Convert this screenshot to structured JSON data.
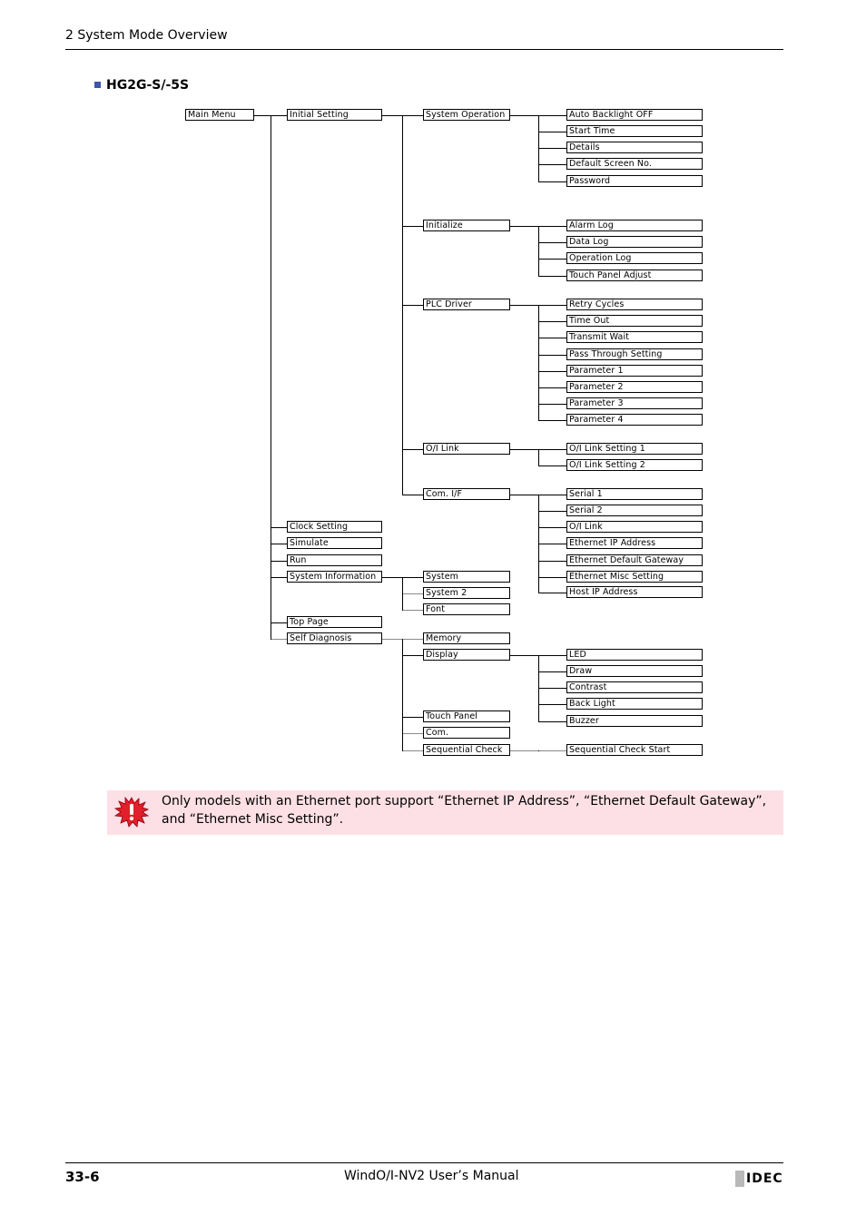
{
  "header": {
    "section": "2 System Mode Overview"
  },
  "section_title": "HG2G-S/-5S",
  "tree": {
    "label": "Main Menu",
    "children": [
      {
        "label": "Initial Setting",
        "children": [
          {
            "label": "System Operation",
            "children": [
              {
                "label": "Auto Backlight OFF"
              },
              {
                "label": "Start Time"
              },
              {
                "label": "Details"
              },
              {
                "label": "Default Screen No."
              },
              {
                "label": "Password"
              }
            ]
          },
          {
            "label": "Initialize",
            "children": [
              {
                "label": "Alarm Log"
              },
              {
                "label": "Data Log"
              },
              {
                "label": "Operation Log"
              },
              {
                "label": "Touch Panel Adjust"
              }
            ]
          },
          {
            "label": "PLC Driver",
            "children": [
              {
                "label": "Retry Cycles"
              },
              {
                "label": "Time Out"
              },
              {
                "label": "Transmit Wait"
              },
              {
                "label": "Pass Through Setting"
              },
              {
                "label": "Parameter 1"
              },
              {
                "label": "Parameter 2"
              },
              {
                "label": "Parameter 3"
              },
              {
                "label": "Parameter 4"
              }
            ]
          },
          {
            "label": "O/I Link",
            "children": [
              {
                "label": "O/I Link Setting 1"
              },
              {
                "label": "O/I Link Setting 2"
              }
            ]
          },
          {
            "label": "Com. I/F",
            "children": [
              {
                "label": "Serial 1"
              },
              {
                "label": "Serial 2"
              },
              {
                "label": "O/I Link"
              },
              {
                "label": "Ethernet IP Address"
              },
              {
                "label": "Ethernet Default Gateway"
              },
              {
                "label": "Ethernet Misc Setting"
              },
              {
                "label": "Host IP Address"
              }
            ]
          }
        ]
      },
      {
        "label": "Clock Setting"
      },
      {
        "label": "Simulate"
      },
      {
        "label": "Run"
      },
      {
        "label": "System Information",
        "children": [
          {
            "label": "System"
          },
          {
            "label": "System 2"
          },
          {
            "label": "Font"
          }
        ]
      },
      {
        "label": "Top Page"
      },
      {
        "label": "Self Diagnosis",
        "children": [
          {
            "label": "Memory"
          },
          {
            "label": "Display",
            "children": [
              {
                "label": "LED"
              },
              {
                "label": "Draw"
              },
              {
                "label": "Contrast"
              },
              {
                "label": "Back Light"
              },
              {
                "label": "Buzzer"
              }
            ]
          },
          {
            "label": "Touch Panel"
          },
          {
            "label": "Com."
          },
          {
            "label": "Sequential Check",
            "children": [
              {
                "label": "Sequential Check Start"
              }
            ]
          }
        ]
      }
    ]
  },
  "note": {
    "icon": "warning-burst-icon",
    "text": "Only models with an Ethernet port support “Ethernet IP Address”, “Ethernet Default Gateway”, and “Ethernet Misc Setting”."
  },
  "footer": {
    "page_number": "33-6",
    "manual_title": "WindO/I-NV2 User’s Manual",
    "logo_text": "IDEC"
  }
}
